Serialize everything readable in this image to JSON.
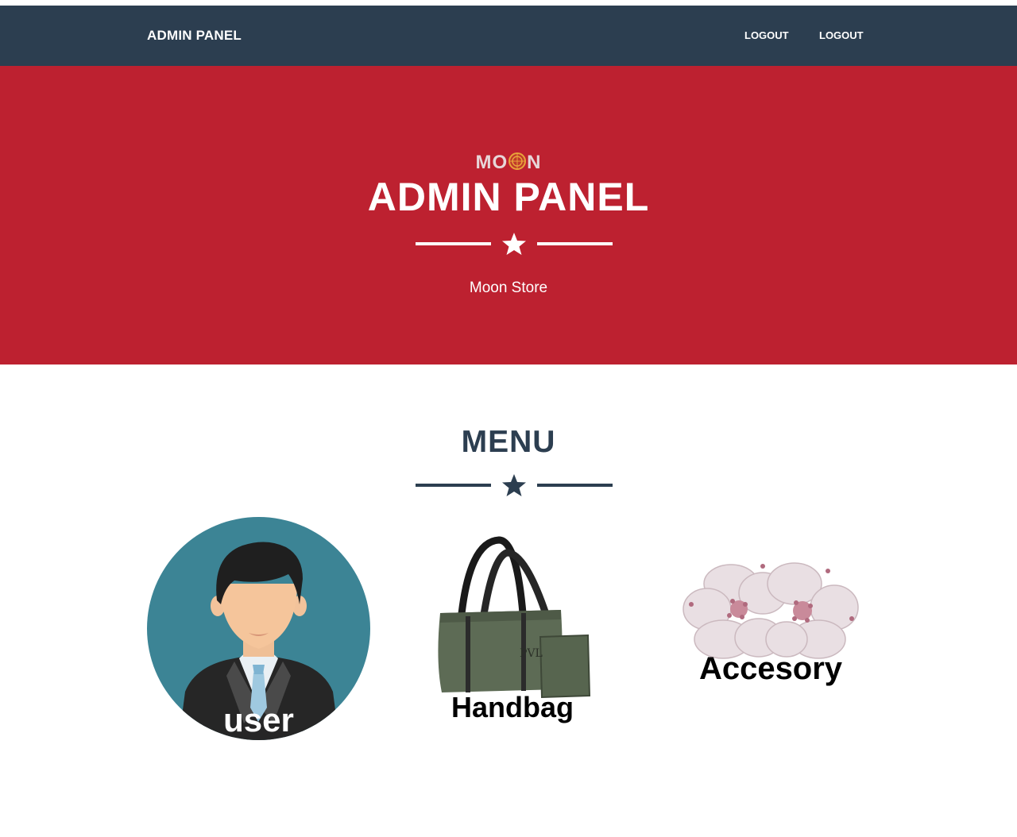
{
  "navbar": {
    "brand": "ADMIN PANEL",
    "links": [
      "LOGOUT",
      "LOGOUT"
    ]
  },
  "masthead": {
    "logo_left": "MO",
    "logo_right": "N",
    "title": "ADMIN PANEL",
    "subtitle": "Moon Store"
  },
  "menu": {
    "title": "MENU",
    "items": [
      {
        "label": "user",
        "icon": "user-avatar-icon"
      },
      {
        "label": "Handbag",
        "icon": "handbag-icon"
      },
      {
        "label": "Accesory",
        "icon": "flower-accessory-icon"
      }
    ]
  },
  "colors": {
    "navbar": "#2c3e50",
    "masthead": "#bd2130",
    "heading": "#2c3e50"
  }
}
